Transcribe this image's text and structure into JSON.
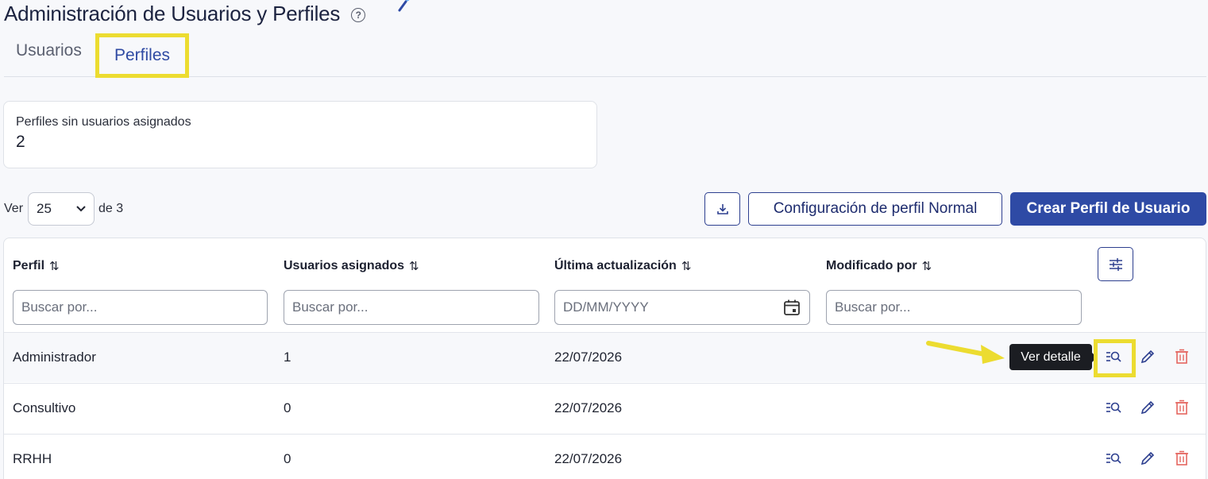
{
  "header": {
    "title": "Administración de Usuarios y Perfiles",
    "help_icon": "?"
  },
  "tabs": [
    {
      "label": "Usuarios"
    },
    {
      "label": "Perfiles"
    }
  ],
  "stat": {
    "label": "Perfiles sin usuarios asignados",
    "value": "2"
  },
  "pagination": {
    "ver": "Ver",
    "page_size": "25",
    "of_text": "de 3"
  },
  "buttons": {
    "config": "Configuración de perfil Normal",
    "create": "Crear Perfil de Usuario"
  },
  "table": {
    "columns": [
      "Perfil",
      "Usuarios asignados",
      "Última actualización",
      "Modificado por"
    ],
    "filters": [
      "Buscar por...",
      "Buscar por...",
      "DD/MM/YYYY",
      "Buscar por..."
    ],
    "rows": [
      {
        "perfil": "Administrador",
        "usuarios": "1",
        "fecha": "22/07/2026",
        "modificado": ""
      },
      {
        "perfil": "Consultivo",
        "usuarios": "0",
        "fecha": "22/07/2026",
        "modificado": ""
      },
      {
        "perfil": "RRHH",
        "usuarios": "0",
        "fecha": "22/07/2026",
        "modificado": ""
      }
    ]
  },
  "tooltip": "Ver detalle",
  "colors": {
    "primary": "#2e4aa5",
    "highlight": "#ecdc30",
    "delete": "#e4655f"
  }
}
